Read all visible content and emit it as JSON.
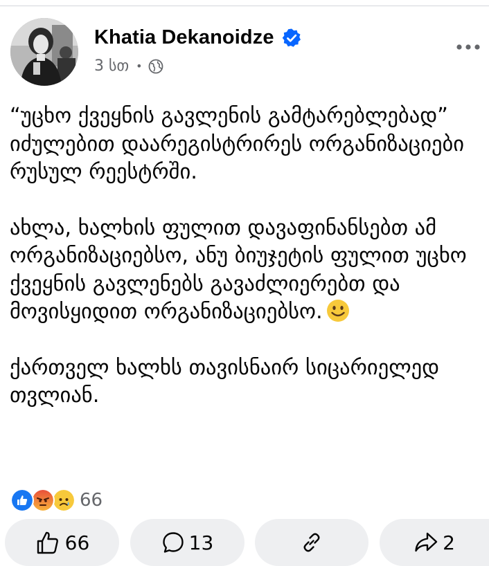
{
  "post": {
    "author": "Khatia Dekanoidze",
    "time": "3 სთ",
    "paragraphs": [
      "“უცხო ქვეყნის გავლენის გამტარებლებად” იძულებით დაარეგისტრირეს ორგანიზაციები რუსულ რეესტრში.",
      "ახლა, ხალხის ფულით დავაფინანსებთ ამ ორგანიზაციებსო, ანუ ბიუჯეტის ფულით უცხო ქვეყნის გავლენებს გავაძლიერებთ და მოვისყიდით ორგანიზაციებსო.",
      "ქართველ ხალხს თავისნაირ სიცარიელედ თვლიან."
    ]
  },
  "reactions": {
    "count": "66"
  },
  "actions": {
    "like_count": "66",
    "comment_count": "13",
    "share_count": "2"
  },
  "icons": [
    "verified-badge-icon",
    "globe-icon",
    "more-options-icon",
    "smile-emoji-icon",
    "like-reaction-icon",
    "angry-reaction-icon",
    "sad-reaction-icon",
    "thumbs-up-icon",
    "comment-icon",
    "link-icon",
    "share-icon"
  ],
  "colors": {
    "verified": "#0866ff",
    "meta": "#65676b",
    "button_bg": "#eeeff1"
  }
}
